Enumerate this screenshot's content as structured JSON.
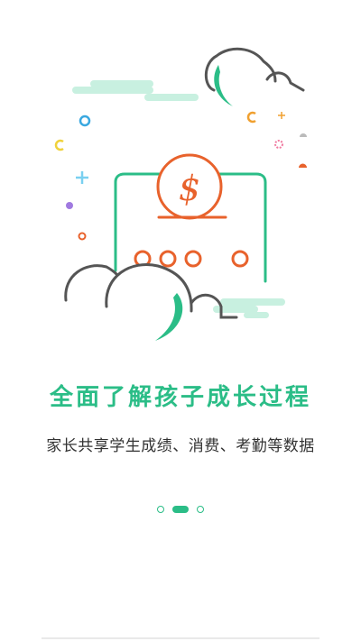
{
  "headline": "全面了解孩子成长过程",
  "description": "家长共享学生成绩、消费、考勤等数据",
  "colors": {
    "accent": "#2bbd87",
    "orange": "#e8622c",
    "cloud_stroke": "#555555",
    "mint": "#c8f0e0"
  },
  "pager": {
    "page_count": 3,
    "current_page": 2
  },
  "illustration": {
    "coin_symbol": "$"
  }
}
